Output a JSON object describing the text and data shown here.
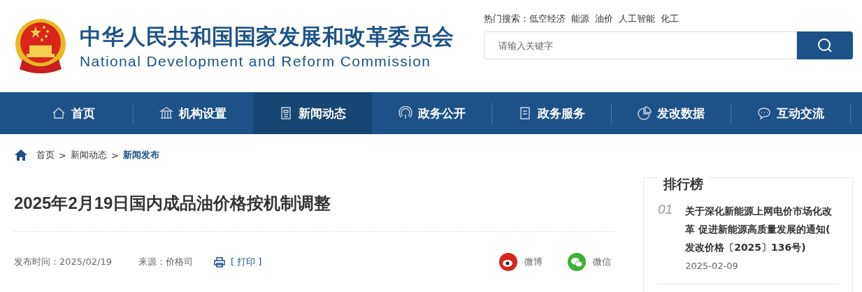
{
  "header": {
    "title": "中华人民共和国国家发展和改革委员会",
    "subtitle": "National Development and Reform Commission"
  },
  "hot_search": {
    "label": "热门搜索：",
    "terms": [
      "低空经济",
      "能源",
      "油价",
      "人工智能",
      "化工"
    ]
  },
  "search": {
    "placeholder": "请输入关键字"
  },
  "nav": [
    {
      "label": "首页",
      "selected": false
    },
    {
      "label": "机构设置",
      "selected": false
    },
    {
      "label": "新闻动态",
      "selected": true
    },
    {
      "label": "政务公开",
      "selected": false
    },
    {
      "label": "政务服务",
      "selected": false
    },
    {
      "label": "发改数据",
      "selected": false
    },
    {
      "label": "互动交流",
      "selected": false
    }
  ],
  "breadcrumb": {
    "separator": ">",
    "items": [
      {
        "label": "首页",
        "current": false
      },
      {
        "label": "新闻动态",
        "current": false
      },
      {
        "label": "新闻发布",
        "current": true
      }
    ]
  },
  "article": {
    "title": "2025年2月19日国内成品油价格按机制调整",
    "published": "发布时间：2025/02/19",
    "source": "来源：价格司",
    "print": "[ 打印 ]",
    "share": [
      "微博",
      "微信"
    ]
  },
  "ranking": {
    "title": "排行榜",
    "items": [
      {
        "number": "01",
        "title": "关于深化新能源上网电价市场化改革 促进新能源高质量发展的通知(发改价格〔2025〕136号)",
        "date": "2025-02-09"
      }
    ]
  }
}
